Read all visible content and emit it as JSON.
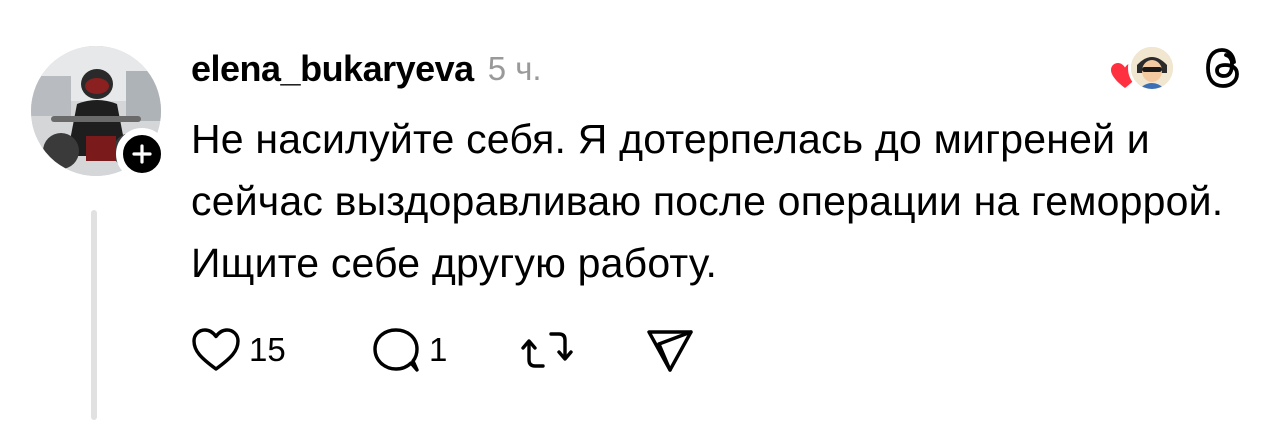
{
  "post": {
    "author": {
      "username": "elena_bukaryeva",
      "avatar_icon": "profile-photo-motorcyclist",
      "follow_icon": "plus-icon"
    },
    "time_ago": "5 ч.",
    "text": "Не насилуйте себя. Я дотерпелась до мигреней и сейчас выздоравливаю после операции на геморрой. Ищите себе другую работу.",
    "reactions": {
      "heart_color": "#ff3040",
      "reactor_avatar_icon": "cartoon-avatar"
    },
    "app_icon": "threads-logo-icon",
    "actions": {
      "like_count": "15",
      "reply_count": "1",
      "repost_icon": "repost-icon",
      "share_icon": "send-icon"
    }
  },
  "colors": {
    "text": "#000000",
    "muted": "#999999",
    "thread_line": "#e1e1e1",
    "heart": "#ff3040"
  }
}
